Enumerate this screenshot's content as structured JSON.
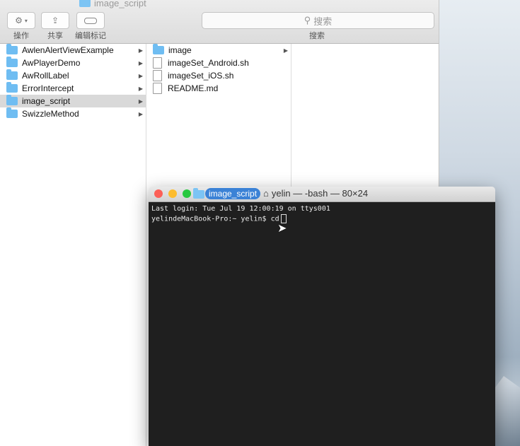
{
  "finder": {
    "title": "image_script",
    "toolbar": {
      "action_label": "操作",
      "share_label": "共享",
      "tags_label": "编辑标记",
      "search_placeholder": "搜索",
      "search_label": "搜索"
    },
    "column1": [
      {
        "name": "AwlenAlertViewExample",
        "type": "folder"
      },
      {
        "name": "AwPlayerDemo",
        "type": "folder"
      },
      {
        "name": "AwRollLabel",
        "type": "folder"
      },
      {
        "name": "ErrorIntercept",
        "type": "folder"
      },
      {
        "name": "image_script",
        "type": "folder",
        "selected": true
      },
      {
        "name": "SwizzleMethod",
        "type": "folder"
      }
    ],
    "column2": [
      {
        "name": "image",
        "type": "folder"
      },
      {
        "name": "imageSet_Android.sh",
        "type": "file"
      },
      {
        "name": "imageSet_iOS.sh",
        "type": "file"
      },
      {
        "name": "README.md",
        "type": "file"
      }
    ]
  },
  "terminal": {
    "drag_tag": "image_script",
    "title": "yelin — -bash — 80×24",
    "lines": [
      "Last login: Tue Jul 19 12:00:19 on ttys001",
      "yelindeMacBook-Pro:~ yelin$ cd"
    ]
  },
  "colors": {
    "folder": "#6fbdf2",
    "selection": "#d9d9d9",
    "terminal_bg": "#1f1f1f",
    "tag_blue": "#3b82d6"
  }
}
